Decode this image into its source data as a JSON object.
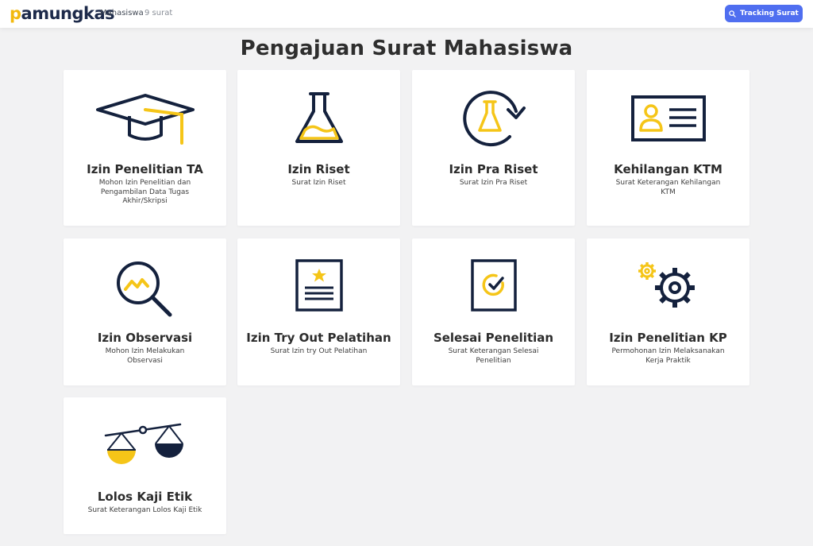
{
  "navbar": {
    "brand_first": "p",
    "brand_rest": "amungkas",
    "link": "Mahasiswa",
    "count": "9 surat",
    "tracking_label": "Tracking Surat"
  },
  "page": {
    "title": "Pengajuan Surat Mahasiswa"
  },
  "colors": {
    "navy": "#14213d",
    "yellow": "#f5c518",
    "button": "#4f6ef0"
  },
  "cards": [
    {
      "title": "Izin Penelitian TA",
      "desc": "Mohon Izin Penelitian dan Pengambilan Data Tugas Akhir/Skripsi",
      "icon": "graduation-cap-icon"
    },
    {
      "title": "Izin Riset",
      "desc": "Surat Izin Riset",
      "icon": "flask-icon"
    },
    {
      "title": "Izin Pra Riset",
      "desc": "Surat Izin Pra Riset",
      "icon": "flask-cycle-icon"
    },
    {
      "title": "Kehilangan KTM",
      "desc": "Surat Keterangan Kehilangan KTM",
      "icon": "id-card-icon"
    },
    {
      "title": "Izin Observasi",
      "desc": "Mohon Izin Melakukan Observasi",
      "icon": "magnifier-chart-icon"
    },
    {
      "title": "Izin Try Out Pelatihan",
      "desc": "Surat Izin try Out Pelatihan",
      "icon": "certificate-icon"
    },
    {
      "title": "Selesai Penelitian",
      "desc": "Surat Keterangan Selesai Penelitian",
      "icon": "check-document-icon"
    },
    {
      "title": "Izin Penelitian KP",
      "desc": "Permohonan Izin Melaksanakan Kerja Praktik",
      "icon": "gears-icon"
    },
    {
      "title": "Lolos Kaji Etik",
      "desc": "Surat Keterangan Lolos Kaji Etik",
      "icon": "balance-scale-icon"
    }
  ]
}
